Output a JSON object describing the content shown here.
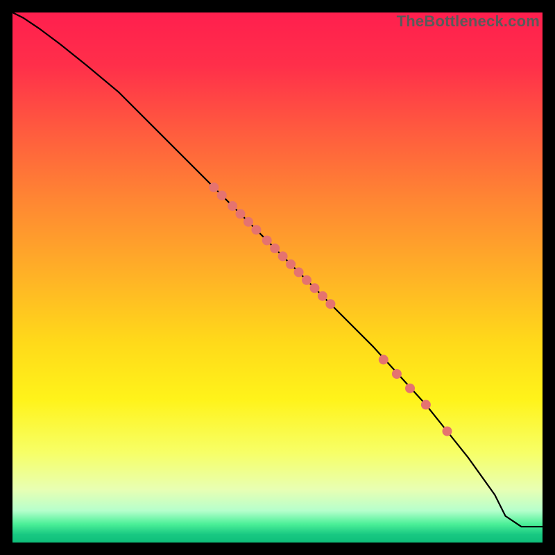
{
  "watermark": "TheBottleneck.com",
  "chart_data": {
    "type": "line",
    "title": "",
    "xlabel": "",
    "ylabel": "",
    "xlim": [
      0,
      100
    ],
    "ylim": [
      0,
      100
    ],
    "gradient_stops": [
      {
        "pos": 0.0,
        "color": "#ff1f4e"
      },
      {
        "pos": 0.1,
        "color": "#ff2f4a"
      },
      {
        "pos": 0.22,
        "color": "#ff5a3f"
      },
      {
        "pos": 0.35,
        "color": "#ff8533"
      },
      {
        "pos": 0.5,
        "color": "#ffb326"
      },
      {
        "pos": 0.62,
        "color": "#ffd91a"
      },
      {
        "pos": 0.73,
        "color": "#fff31a"
      },
      {
        "pos": 0.83,
        "color": "#f7ff66"
      },
      {
        "pos": 0.9,
        "color": "#e8ffb3"
      },
      {
        "pos": 0.94,
        "color": "#b6ffcc"
      },
      {
        "pos": 0.965,
        "color": "#4cf098"
      },
      {
        "pos": 0.985,
        "color": "#18c882"
      },
      {
        "pos": 1.0,
        "color": "#0fbf7a"
      }
    ],
    "series": [
      {
        "name": "curve",
        "x": [
          0,
          2,
          5,
          9,
          14,
          20,
          28,
          38,
          48,
          58,
          68,
          78,
          86,
          91,
          93,
          96,
          100
        ],
        "y": [
          100,
          99,
          97,
          94,
          90,
          85,
          77,
          67,
          57,
          47,
          37,
          26,
          16,
          9,
          5,
          3,
          3
        ]
      }
    ],
    "markers": {
      "name": "dots",
      "color": "#e5736f",
      "radius": 7,
      "points": [
        {
          "x": 38.0,
          "y": 67.0
        },
        {
          "x": 39.5,
          "y": 65.5
        },
        {
          "x": 41.5,
          "y": 63.5
        },
        {
          "x": 43.0,
          "y": 62.0
        },
        {
          "x": 44.5,
          "y": 60.5
        },
        {
          "x": 46.0,
          "y": 59.0
        },
        {
          "x": 48.0,
          "y": 57.0
        },
        {
          "x": 49.5,
          "y": 55.5
        },
        {
          "x": 51.0,
          "y": 54.0
        },
        {
          "x": 52.5,
          "y": 52.5
        },
        {
          "x": 54.0,
          "y": 51.0
        },
        {
          "x": 55.5,
          "y": 49.5
        },
        {
          "x": 57.0,
          "y": 48.0
        },
        {
          "x": 58.5,
          "y": 46.5
        },
        {
          "x": 60.0,
          "y": 45.0
        },
        {
          "x": 70.0,
          "y": 34.5
        },
        {
          "x": 72.5,
          "y": 31.8
        },
        {
          "x": 75.0,
          "y": 29.1
        },
        {
          "x": 78.0,
          "y": 26.0
        },
        {
          "x": 82.0,
          "y": 21.0
        }
      ]
    }
  }
}
